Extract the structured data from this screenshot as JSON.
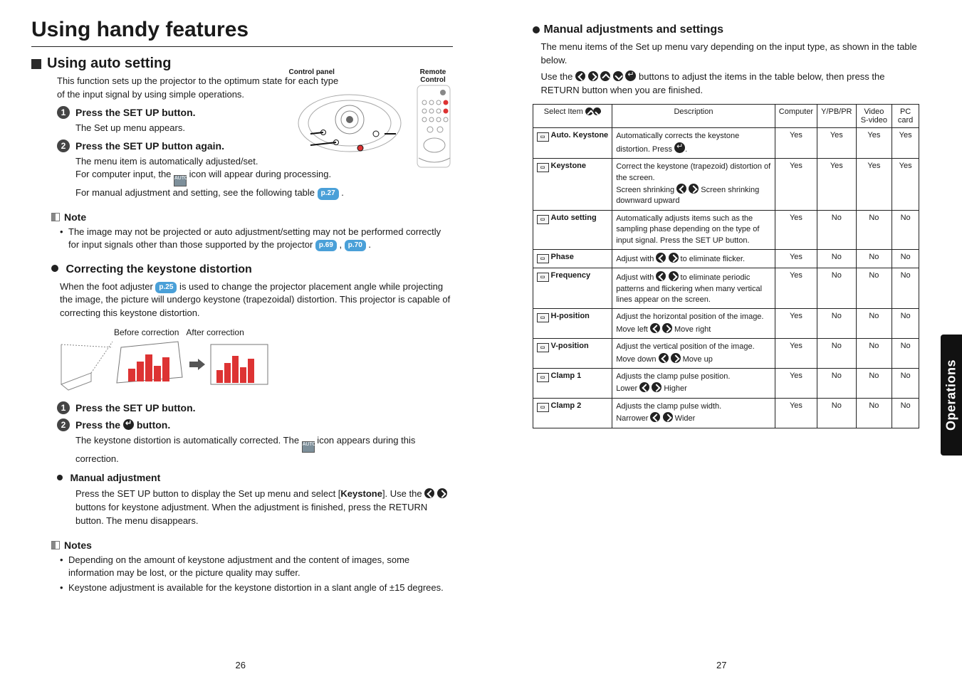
{
  "title": "Using handy features",
  "page_left": "26",
  "page_right": "27",
  "sidetab": "Operations",
  "sec1": {
    "heading": "Using auto setting",
    "intro": "This function sets up the projector to the optimum state for each type of the input signal by using simple operations.",
    "panel_label_left": "Control panel",
    "panel_label_right": "Remote Control",
    "step1": "Press the SET UP button.",
    "step1_body": "The Set up menu appears.",
    "step2": "Press the SET UP button again.",
    "step2_body_a": "The menu item is automatically adjusted/set.",
    "step2_body_b_pre": "For computer input, the ",
    "step2_body_b_post": " icon will appear during processing.",
    "step2_body_c_pre": "For manual adjustment and setting, see the following table ",
    "step2_body_c_link": "p.27",
    "note_heading": "Note",
    "note1_pre": "The image may not be projected or auto adjustment/setting may not be performed correctly for input signals other than those supported by the projector ",
    "note1_l1": "p.69",
    "note1_sep": " , ",
    "note1_l2": "p.70",
    "note1_post": " ."
  },
  "sec2": {
    "heading": "Correcting the keystone distortion",
    "intro_pre": "When the foot adjuster ",
    "intro_link": "p.25",
    "intro_post": " is used to change the projector placement angle while projecting the image, the picture will undergo keystone (trapezoidal) distortion. This projector is capable of correcting this keystone distortion.",
    "fig_before": "Before correction",
    "fig_after": "After correction",
    "step1": "Press the SET UP button.",
    "step2_pre": "Press the ",
    "step2_post": " button.",
    "step2_body_pre": "The keystone distortion is automatically corrected. The ",
    "step2_body_post": " icon appears during this correction.",
    "manual_heading": "Manual adjustment",
    "manual_body_pre": "Press the SET UP button to display the Set up menu and select [",
    "manual_body_bold": "Keystone",
    "manual_body_mid": "]. Use the ",
    "manual_body_post": " buttons for keystone adjustment. When the adjustment is finished, press the RETURN button. The menu disappears.",
    "notes_heading": "Notes",
    "notes1": "Depending on the amount of keystone adjustment and the content of images, some information may be lost, or the picture quality may suffer.",
    "notes2": "Keystone adjustment is available for the keystone distortion in a slant angle of ±15 degrees."
  },
  "sec3": {
    "heading": "Manual adjustments and settings",
    "intro": "The menu items of the Set up menu vary depending on the input type, as shown in the table below.",
    "intro2_pre": "Use the ",
    "intro2_post": " buttons to adjust the items in the table below, then press the RETURN button when you are finished.",
    "th_select": "Select Item",
    "th_desc": "Description",
    "th_comp": "Computer",
    "th_ypbpr": "Y/PB/PR",
    "th_svideo": "Video S-video",
    "th_pccard": "PC card"
  },
  "chart_data": {
    "type": "table",
    "columns": [
      "Select Item",
      "Description",
      "Computer",
      "Y/PB/PR",
      "Video S-video",
      "PC card"
    ],
    "rows": [
      {
        "name": "Auto. Keystone",
        "desc": "Automatically corrects the keystone distortion. Press ↵.",
        "c": "Yes",
        "y": "Yes",
        "v": "Yes",
        "p": "Yes"
      },
      {
        "name": "Keystone",
        "desc": "Correct the keystone (trapezoid) distortion of the screen.\nScreen shrinking ◀ ▶ Screen shrinking\ndownward            upward",
        "c": "Yes",
        "y": "Yes",
        "v": "Yes",
        "p": "Yes"
      },
      {
        "name": "Auto setting",
        "desc": "Automatically adjusts items such as the sampling phase depending on the type of input signal. Press the SET UP button.",
        "c": "Yes",
        "y": "No",
        "v": "No",
        "p": "No"
      },
      {
        "name": "Phase",
        "desc": "Adjust with ◀ ▶ to eliminate flicker.",
        "c": "Yes",
        "y": "No",
        "v": "No",
        "p": "No"
      },
      {
        "name": "Frequency",
        "desc": "Adjust with ◀ ▶ to eliminate periodic patterns and flickering when many vertical lines appear on the screen.",
        "c": "Yes",
        "y": "No",
        "v": "No",
        "p": "No"
      },
      {
        "name": "H-position",
        "desc": "Adjust the horizontal position of the image.\nMove left ◀ ▶ Move right",
        "c": "Yes",
        "y": "No",
        "v": "No",
        "p": "No"
      },
      {
        "name": "V-position",
        "desc": "Adjust the vertical position of the image.\nMove down ◀ ▶ Move up",
        "c": "Yes",
        "y": "No",
        "v": "No",
        "p": "No"
      },
      {
        "name": "Clamp 1",
        "desc": "Adjusts the clamp pulse position.\nLower ◀ ▶ Higher",
        "c": "Yes",
        "y": "No",
        "v": "No",
        "p": "No"
      },
      {
        "name": "Clamp 2",
        "desc": "Adjusts the clamp pulse width.\nNarrower ◀ ▶ Wider",
        "c": "Yes",
        "y": "No",
        "v": "No",
        "p": "No"
      }
    ]
  }
}
